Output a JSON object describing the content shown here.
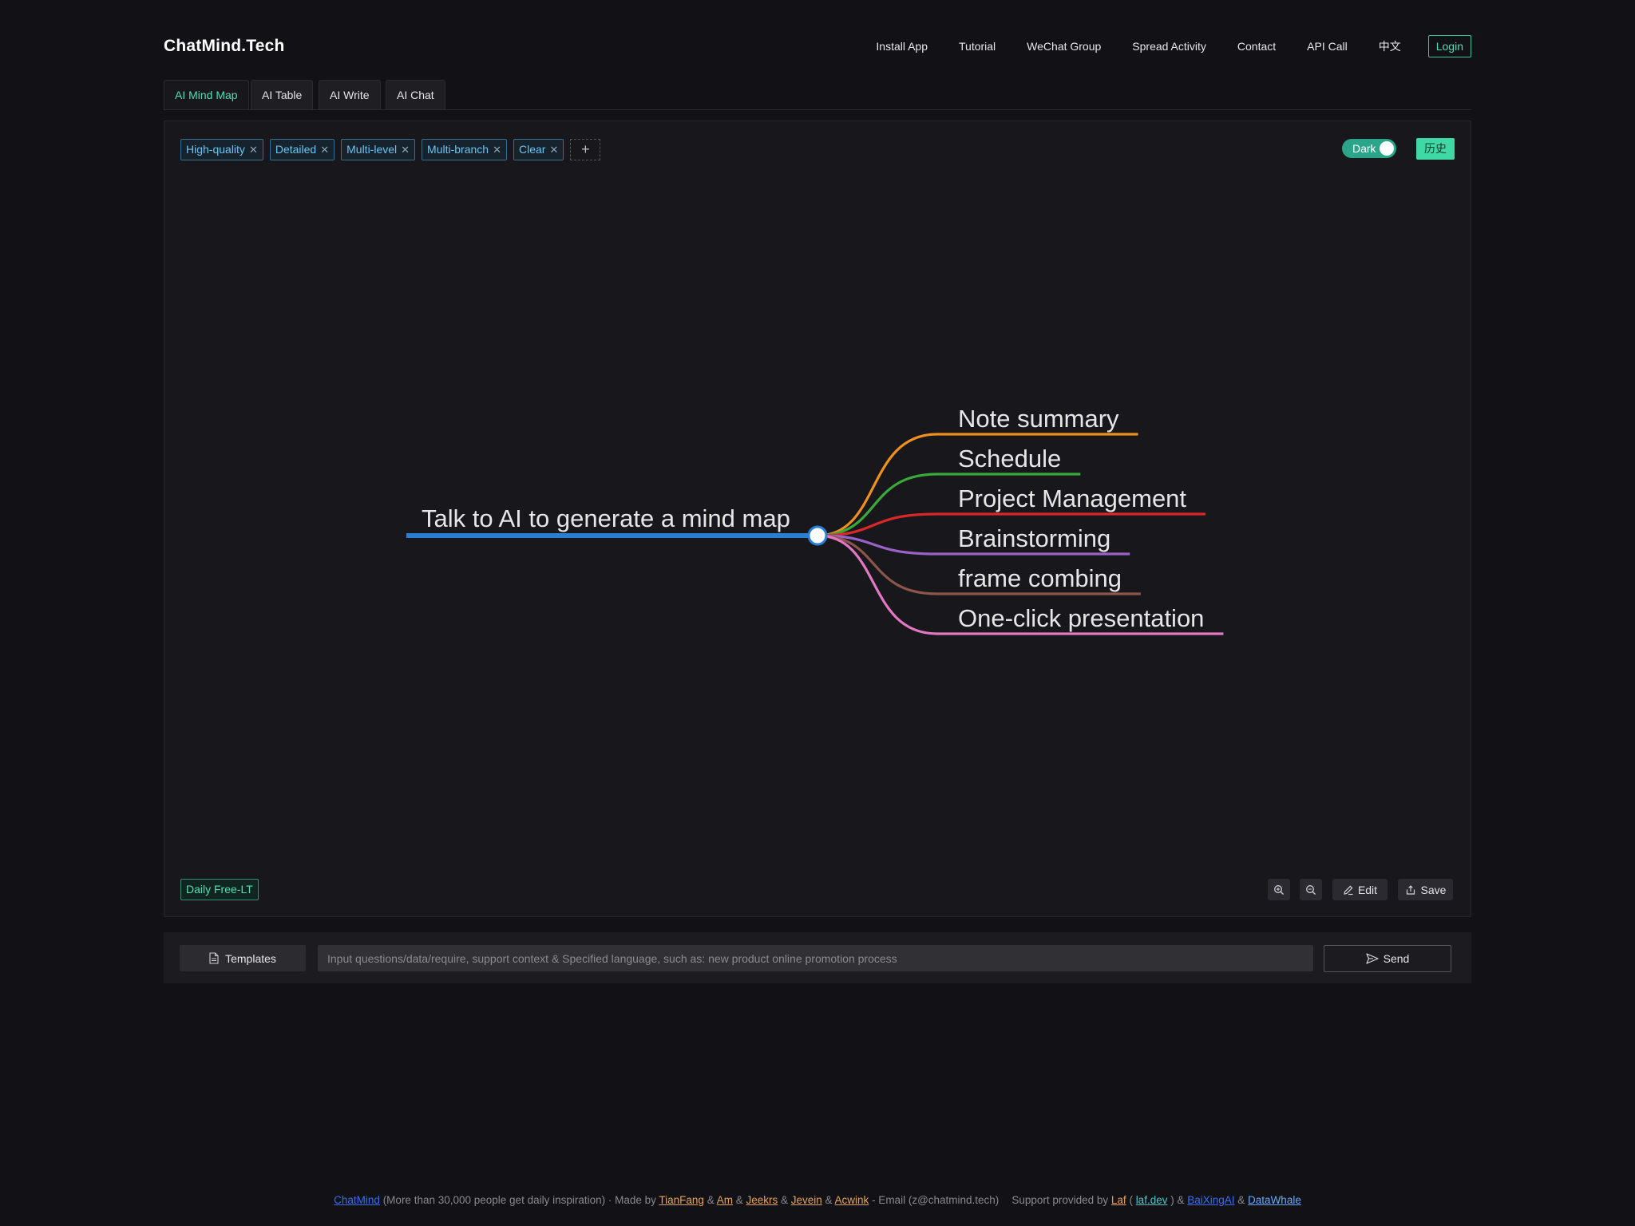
{
  "header": {
    "brand": "ChatMind.Tech",
    "nav": [
      "Install App",
      "Tutorial",
      "WeChat Group",
      "Spread Activity",
      "Contact",
      "API Call",
      "中文"
    ],
    "login": "Login"
  },
  "tabs": [
    {
      "label": "AI Mind Map",
      "active": true
    },
    {
      "label": "AI Table",
      "active": false
    },
    {
      "label": "AI Write",
      "active": false
    },
    {
      "label": "AI Chat",
      "active": false
    }
  ],
  "chips": [
    "High-quality",
    "Detailed",
    "Multi-level",
    "Multi-branch",
    "Clear"
  ],
  "chip_add": "+",
  "theme_toggle": {
    "label": "Dark",
    "on": true
  },
  "history_button": "历史",
  "mindmap": {
    "root": "Talk to AI to generate a mind map",
    "root_color": "#2a7fd4",
    "branches": [
      {
        "label": "Note summary",
        "color": "#f0901e"
      },
      {
        "label": "Schedule",
        "color": "#3aa83a"
      },
      {
        "label": "Project Management",
        "color": "#d92828"
      },
      {
        "label": "Brainstorming",
        "color": "#9a62c8"
      },
      {
        "label": "frame combing",
        "color": "#8c564b"
      },
      {
        "label": "One-click presentation",
        "color": "#e377c2"
      }
    ]
  },
  "daily_badge": "Daily Free-LT",
  "toolbar": {
    "zoom_in_icon": "zoom-in-icon",
    "zoom_out_icon": "zoom-out-icon",
    "edit": "Edit",
    "save": "Save"
  },
  "inputbar": {
    "templates": "Templates",
    "placeholder": "Input questions/data/require, support context & Specified language, such as: new product online promotion process",
    "send": "Send"
  },
  "footer": {
    "chatmind": "ChatMind",
    "desc": " (More than 30,000 people get daily inspiration) · Made by ",
    "authors": [
      "TianFang",
      "Am",
      "Jeekrs",
      "Jevein",
      "Acwink"
    ],
    "sep": " & ",
    "email": " - Email (z@chatmind.tech)",
    "support": "Support provided by ",
    "laf": "Laf",
    "laf_open": " ( ",
    "lafdev": "laf.dev",
    "laf_close": " ) & ",
    "baixing": "BaiXingAI",
    "datawhale": "DataWhale"
  },
  "colors": {
    "accent": "#4fe0b0",
    "bg": "#111116",
    "panel": "#17171c"
  }
}
